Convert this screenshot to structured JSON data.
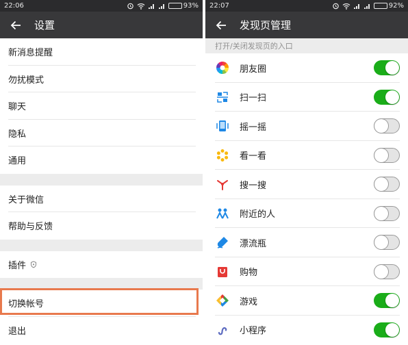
{
  "left": {
    "status": {
      "time": "22:06",
      "battery": "93%",
      "battery_level": 0.93
    },
    "title": "设置",
    "group1": [
      "新消息提醒",
      "勿扰模式",
      "聊天",
      "隐私",
      "通用"
    ],
    "group2": [
      "关于微信",
      "帮助与反馈"
    ],
    "plugins_label": "插件",
    "account_switch_label": "切换帐号",
    "logout_label": "退出"
  },
  "right": {
    "status": {
      "time": "22:07",
      "battery": "92%",
      "battery_level": 0.92
    },
    "title": "发现页管理",
    "section_header": "打开/关闭发现页的入口",
    "items": [
      {
        "label": "朋友圈",
        "icon": "moments-icon",
        "enabled": true
      },
      {
        "label": "扫一扫",
        "icon": "scan-icon",
        "enabled": true
      },
      {
        "label": "摇一摇",
        "icon": "shake-icon",
        "enabled": false
      },
      {
        "label": "看一看",
        "icon": "top-stories-icon",
        "enabled": false
      },
      {
        "label": "搜一搜",
        "icon": "search-icon",
        "enabled": false
      },
      {
        "label": "附近的人",
        "icon": "people-nearby-icon",
        "enabled": false
      },
      {
        "label": "漂流瓶",
        "icon": "drift-bottle-icon",
        "enabled": false
      },
      {
        "label": "购物",
        "icon": "shopping-icon",
        "enabled": false
      },
      {
        "label": "游戏",
        "icon": "games-icon",
        "enabled": true
      },
      {
        "label": "小程序",
        "icon": "mini-programs-icon",
        "enabled": true
      }
    ]
  },
  "colors": {
    "accent_green": "#1aad19",
    "highlight_orange": "#e8794d",
    "titlebar": "#38383a"
  }
}
